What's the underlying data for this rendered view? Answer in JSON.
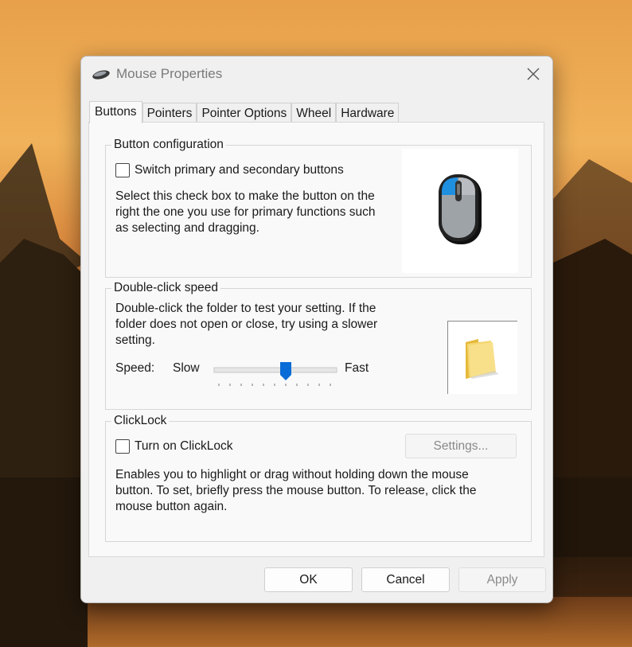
{
  "window": {
    "title": "Mouse Properties"
  },
  "tabs": [
    {
      "label": "Buttons",
      "active": true
    },
    {
      "label": "Pointers",
      "active": false
    },
    {
      "label": "Pointer Options",
      "active": false
    },
    {
      "label": "Wheel",
      "active": false
    },
    {
      "label": "Hardware",
      "active": false
    }
  ],
  "button_config": {
    "heading": "Button configuration",
    "checkbox_label": "Switch primary and secondary buttons",
    "checked": false,
    "description_lines": [
      "Select this check box to make the button on the",
      "right the one you use for primary functions such",
      "as selecting and dragging."
    ]
  },
  "double_click": {
    "heading": "Double-click speed",
    "description_lines": [
      "Double-click the folder to test your setting. If the",
      "folder does not open or close, try using a slower",
      "setting."
    ],
    "speed_label": "Speed:",
    "slow_label": "Slow",
    "fast_label": "Fast",
    "slider_value": 0.6
  },
  "clicklock": {
    "heading": "ClickLock",
    "checkbox_label": "Turn on ClickLock",
    "checked": false,
    "settings_label": "Settings...",
    "description_lines": [
      "Enables you to highlight or drag without holding down the mouse",
      "button. To set, briefly press the mouse button. To release, click the",
      "mouse button again."
    ]
  },
  "footer": {
    "ok_label": "OK",
    "cancel_label": "Cancel",
    "apply_label": "Apply"
  },
  "colors": {
    "accent": "#0a6cd6",
    "folder": "#f2d46a"
  }
}
